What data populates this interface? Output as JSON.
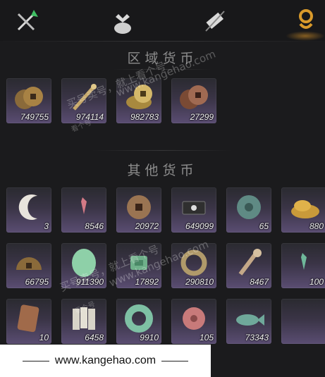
{
  "tabs": [
    {
      "name": "weapon-icon"
    },
    {
      "name": "pouch-icon"
    },
    {
      "name": "scroll-icon"
    },
    {
      "name": "currency-icon",
      "active": true
    }
  ],
  "sections": {
    "regional_title": "区域货币",
    "other_title": "其他货币"
  },
  "regional_items": [
    {
      "icon": "copper-coins-icon",
      "count": "749755"
    },
    {
      "icon": "coin-string-icon",
      "count": "974114"
    },
    {
      "icon": "gold-coins-icon",
      "count": "982783"
    },
    {
      "icon": "bronze-coins-icon",
      "count": "27299"
    }
  ],
  "other_items": [
    {
      "icon": "crescent-jade-icon",
      "count": "3"
    },
    {
      "icon": "red-talisman-icon",
      "count": "8546"
    },
    {
      "icon": "square-hole-coin-icon",
      "count": "20972"
    },
    {
      "icon": "ticket-icon",
      "count": "649099"
    },
    {
      "icon": "jade-disc-icon",
      "count": "65"
    },
    {
      "icon": "grain-pile-icon",
      "count": "880"
    },
    {
      "icon": "half-disc-coin-icon",
      "count": "66795"
    },
    {
      "icon": "green-jade-icon",
      "count": "911390"
    },
    {
      "icon": "jade-slip-icon",
      "count": "17892"
    },
    {
      "icon": "bracelet-icon",
      "count": "290810"
    },
    {
      "icon": "coin-sword-icon",
      "count": "8467"
    },
    {
      "icon": "green-talisman-icon",
      "count": "100"
    },
    {
      "icon": "copper-plate-icon",
      "count": "10"
    },
    {
      "icon": "paper-charms-icon",
      "count": "6458"
    },
    {
      "icon": "jade-ring-icon",
      "count": "9910"
    },
    {
      "icon": "rose-stone-icon",
      "count": "105"
    },
    {
      "icon": "jade-fish-icon",
      "count": "73343"
    },
    {
      "icon": "empty-slot",
      "count": ""
    }
  ],
  "watermarks": [
    {
      "text": "买号卖号，就上看个号",
      "class": ""
    },
    {
      "text": "www.kangehao.com",
      "class": ""
    },
    {
      "text": "买号卖号，就上看个号",
      "class": ""
    },
    {
      "text": "www.kangehao.com",
      "class": ""
    },
    {
      "text": "看个号",
      "class": "small"
    },
    {
      "text": "看个号",
      "class": "small"
    }
  ],
  "footer": {
    "url": "www.kangehao.com"
  },
  "colors": {
    "active_tab": "#d99a2b",
    "background": "#1b1b1d",
    "slot_bottom": "#5a4d72"
  }
}
